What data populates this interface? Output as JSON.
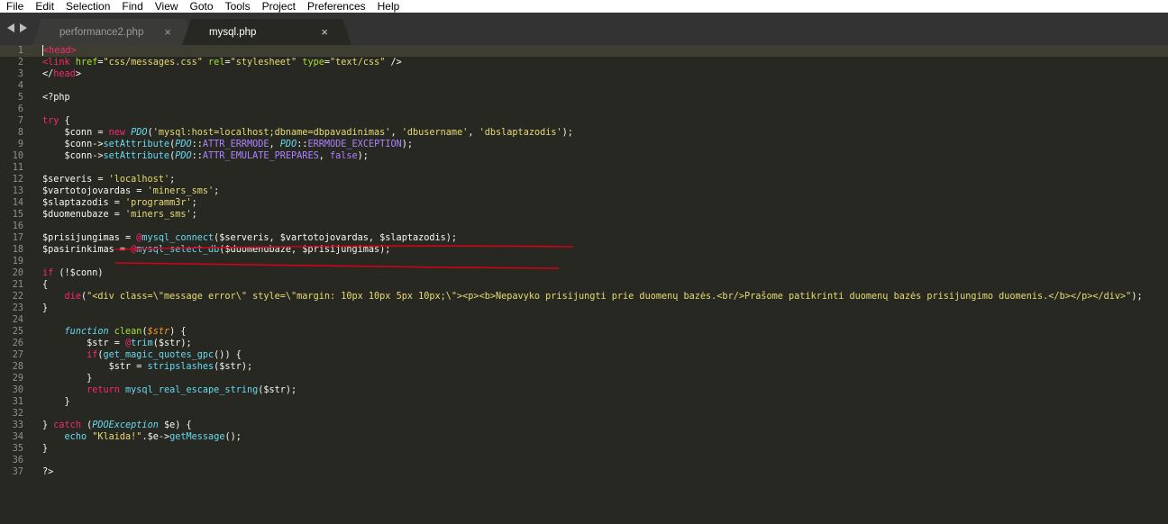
{
  "menu": [
    "File",
    "Edit",
    "Selection",
    "Find",
    "View",
    "Goto",
    "Tools",
    "Project",
    "Preferences",
    "Help"
  ],
  "tabs": [
    {
      "label": "performance2.php",
      "close": "×",
      "active": false
    },
    {
      "label": "mysql.php",
      "close": "×",
      "active": true
    }
  ],
  "colors": {
    "editor_bg": "#272822",
    "tabbar_bg": "#323332",
    "keyword": "#f92672",
    "string": "#e6db74",
    "function": "#66d9ef",
    "attribute": "#a6e22e",
    "scribble": "#d0021b"
  },
  "code": [
    {
      "n": "1",
      "t": [
        [
          "tag",
          "<head>"
        ]
      ]
    },
    {
      "n": "2",
      "t": [
        [
          "tag",
          "<link "
        ],
        [
          "attr",
          "href"
        ],
        [
          "plain",
          "="
        ],
        [
          "str",
          "\"css/messages.css\""
        ],
        [
          "plain",
          " "
        ],
        [
          "attr",
          "rel"
        ],
        [
          "plain",
          "="
        ],
        [
          "str",
          "\"stylesheet\""
        ],
        [
          "plain",
          " "
        ],
        [
          "attr",
          "type"
        ],
        [
          "plain",
          "="
        ],
        [
          "str",
          "\"text/css\""
        ],
        [
          "plain",
          " />"
        ]
      ]
    },
    {
      "n": "3",
      "t": [
        [
          "plain",
          "</"
        ],
        [
          "tag",
          "head"
        ],
        [
          "plain",
          ">"
        ]
      ]
    },
    {
      "n": "4",
      "t": []
    },
    {
      "n": "5",
      "t": [
        [
          "plain",
          "<?php"
        ]
      ]
    },
    {
      "n": "6",
      "t": []
    },
    {
      "n": "7",
      "t": [
        [
          "kw",
          "try"
        ],
        [
          "plain",
          " {"
        ]
      ]
    },
    {
      "n": "8",
      "t": [
        [
          "plain",
          "    $conn = "
        ],
        [
          "kw",
          "new"
        ],
        [
          "plain",
          " "
        ],
        [
          "it",
          "PDO"
        ],
        [
          "plain",
          "("
        ],
        [
          "str",
          "'mysql:host=localhost;dbname=dbpavadinimas'"
        ],
        [
          "plain",
          ", "
        ],
        [
          "str",
          "'dbusername'"
        ],
        [
          "plain",
          ", "
        ],
        [
          "str",
          "'dbslaptazodis'"
        ],
        [
          "plain",
          ");"
        ]
      ]
    },
    {
      "n": "9",
      "t": [
        [
          "plain",
          "    $conn->"
        ],
        [
          "fn",
          "setAttribute"
        ],
        [
          "plain",
          "("
        ],
        [
          "it",
          "PDO"
        ],
        [
          "plain",
          "::"
        ],
        [
          "num",
          "ATTR_ERRMODE"
        ],
        [
          "plain",
          ", "
        ],
        [
          "it",
          "PDO"
        ],
        [
          "plain",
          "::"
        ],
        [
          "num",
          "ERRMODE_EXCEPTION"
        ],
        [
          "plain",
          ");"
        ]
      ]
    },
    {
      "n": "10",
      "t": [
        [
          "plain",
          "    $conn->"
        ],
        [
          "fn",
          "setAttribute"
        ],
        [
          "plain",
          "("
        ],
        [
          "it",
          "PDO"
        ],
        [
          "plain",
          "::"
        ],
        [
          "num",
          "ATTR_EMULATE_PREPARES"
        ],
        [
          "plain",
          ", "
        ],
        [
          "num",
          "false"
        ],
        [
          "plain",
          ");"
        ]
      ]
    },
    {
      "n": "11",
      "t": []
    },
    {
      "n": "12",
      "t": [
        [
          "plain",
          "$serveris = "
        ],
        [
          "str",
          "'localhost'"
        ],
        [
          "plain",
          ";"
        ]
      ]
    },
    {
      "n": "13",
      "t": [
        [
          "plain",
          "$vartotojovardas = "
        ],
        [
          "str",
          "'miners_sms'"
        ],
        [
          "plain",
          ";"
        ]
      ]
    },
    {
      "n": "14",
      "t": [
        [
          "plain",
          "$slaptazodis = "
        ],
        [
          "str",
          "'programm3r'"
        ],
        [
          "plain",
          ";"
        ]
      ]
    },
    {
      "n": "15",
      "t": [
        [
          "plain",
          "$duomenubaze = "
        ],
        [
          "str",
          "'miners_sms'"
        ],
        [
          "plain",
          ";"
        ]
      ]
    },
    {
      "n": "16",
      "t": []
    },
    {
      "n": "17",
      "t": [
        [
          "plain",
          "$prisijungimas = "
        ],
        [
          "kw",
          "@"
        ],
        [
          "fn",
          "mysql_connect"
        ],
        [
          "plain",
          "($serveris, $vartotojovardas, $slaptazodis);"
        ]
      ]
    },
    {
      "n": "18",
      "t": [
        [
          "plain",
          "$pasirinkimas = "
        ],
        [
          "kw",
          "@"
        ],
        [
          "fn",
          "mysql_select_db"
        ],
        [
          "plain",
          "($duomenubaze, $prisijungimas);"
        ]
      ]
    },
    {
      "n": "19",
      "t": []
    },
    {
      "n": "20",
      "t": [
        [
          "kw",
          "if"
        ],
        [
          "plain",
          " (!$conn)"
        ]
      ]
    },
    {
      "n": "21",
      "t": [
        [
          "plain",
          "{"
        ]
      ]
    },
    {
      "n": "22",
      "t": [
        [
          "plain",
          "    "
        ],
        [
          "kw",
          "die"
        ],
        [
          "plain",
          "("
        ],
        [
          "str",
          "\"<div class=\\\"message error\\\" style=\\\"margin: 10px 10px 5px 10px;\\\"><p><b>Nepavyko prisijungti prie duomenų bazės.<br/>Prašome patikrinti duomenų bazės prisijungimo duomenis.</b></p></div>\""
        ],
        [
          "plain",
          ");"
        ]
      ]
    },
    {
      "n": "23",
      "t": [
        [
          "plain",
          "}"
        ]
      ]
    },
    {
      "n": "24",
      "t": []
    },
    {
      "n": "25",
      "t": [
        [
          "plain",
          "    "
        ],
        [
          "it",
          "function"
        ],
        [
          "plain",
          " "
        ],
        [
          "attr",
          "clean"
        ],
        [
          "plain",
          "("
        ],
        [
          "param",
          "$str"
        ],
        [
          "plain",
          ") {"
        ]
      ]
    },
    {
      "n": "26",
      "t": [
        [
          "plain",
          "        $str = "
        ],
        [
          "kw",
          "@"
        ],
        [
          "fn",
          "trim"
        ],
        [
          "plain",
          "($str);"
        ]
      ]
    },
    {
      "n": "27",
      "t": [
        [
          "plain",
          "        "
        ],
        [
          "kw",
          "if"
        ],
        [
          "plain",
          "("
        ],
        [
          "fn",
          "get_magic_quotes_gpc"
        ],
        [
          "plain",
          "()) {"
        ]
      ]
    },
    {
      "n": "28",
      "t": [
        [
          "plain",
          "            $str = "
        ],
        [
          "fn",
          "stripslashes"
        ],
        [
          "plain",
          "($str);"
        ]
      ]
    },
    {
      "n": "29",
      "t": [
        [
          "plain",
          "        }"
        ]
      ]
    },
    {
      "n": "30",
      "t": [
        [
          "plain",
          "        "
        ],
        [
          "kw",
          "return"
        ],
        [
          "plain",
          " "
        ],
        [
          "fn",
          "mysql_real_escape_string"
        ],
        [
          "plain",
          "($str);"
        ]
      ]
    },
    {
      "n": "31",
      "t": [
        [
          "plain",
          "    }"
        ]
      ]
    },
    {
      "n": "32",
      "t": []
    },
    {
      "n": "33",
      "t": [
        [
          "plain",
          "} "
        ],
        [
          "kw",
          "catch"
        ],
        [
          "plain",
          " ("
        ],
        [
          "it",
          "PDOException"
        ],
        [
          "plain",
          " $e) {"
        ]
      ]
    },
    {
      "n": "34",
      "t": [
        [
          "plain",
          "    "
        ],
        [
          "fn",
          "echo"
        ],
        [
          "plain",
          " "
        ],
        [
          "str",
          "\"Klaida!\""
        ],
        [
          "plain",
          "."
        ],
        [
          "plain",
          "$e->"
        ],
        [
          "fn",
          "getMessage"
        ],
        [
          "plain",
          "();"
        ]
      ]
    },
    {
      "n": "35",
      "t": [
        [
          "plain",
          "}"
        ]
      ]
    },
    {
      "n": "36",
      "t": []
    },
    {
      "n": "37",
      "t": [
        [
          "plain",
          "?>"
        ]
      ]
    }
  ]
}
